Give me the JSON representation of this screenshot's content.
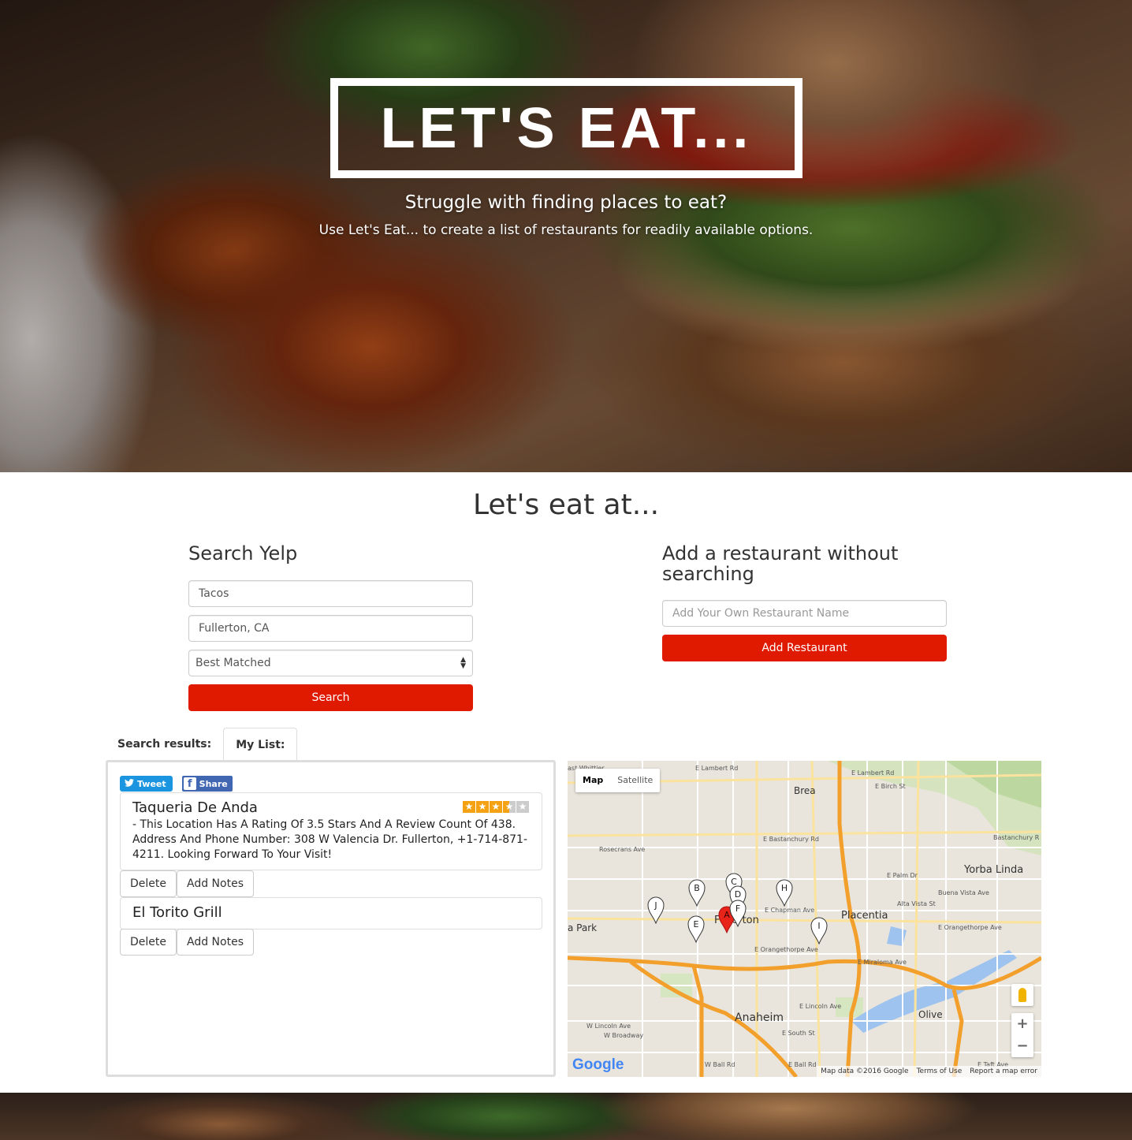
{
  "hero": {
    "title": "LET'S EAT...",
    "subtitle": "Struggle with finding places to eat?",
    "tagline": "Use Let's Eat... to create a list of restaurants for readily available options."
  },
  "section_title": "Let's eat at...",
  "search": {
    "heading": "Search Yelp",
    "term_value": "Tacos",
    "location_value": "Fullerton, CA",
    "sort_value": "Best Matched",
    "button_label": "Search"
  },
  "add": {
    "heading": "Add a restaurant without searching",
    "placeholder": "Add Your Own Restaurant Name",
    "button_label": "Add Restaurant"
  },
  "tabs": [
    {
      "label": "Search results:",
      "active": false
    },
    {
      "label": "My List:",
      "active": true
    }
  ],
  "share": {
    "tweet_label": "Tweet",
    "share_label": "Share"
  },
  "list": [
    {
      "name": "Taqueria De Anda",
      "rating": 3.5,
      "description": "- This Location Has A Rating Of 3.5 Stars And A Review Count Of 438. Address And Phone Number: 308 W Valencia Dr. Fullerton, +1-714-871-4211. Looking Forward To Your Visit!",
      "delete_label": "Delete",
      "notes_label": "Add Notes"
    },
    {
      "name": "El Torito Grill",
      "delete_label": "Delete",
      "notes_label": "Add Notes"
    }
  ],
  "map": {
    "type_map": "Map",
    "type_satellite": "Satellite",
    "labels": {
      "brea": "Brea",
      "yorba_linda": "Yorba Linda",
      "placentia": "Placentia",
      "fullerton": "Fullerton",
      "anaheim": "Anaheim",
      "olive": "Olive",
      "park": "a Park",
      "lambert": "E Lambert Rd",
      "lambert2": "E Lambert Rd",
      "birch": "E Birch St",
      "bastanchury": "E Bastanchury Rd",
      "bastanchury2": "Bastanchury R",
      "rosecrans": "Rosecrans Ave",
      "chapman": "E Chapman Ave",
      "orangethorpe": "E Orangethorpe Ave",
      "orangethorpe2": "E Orangethorpe Ave",
      "miraloma": "E Miraloma Ave",
      "lincoln": "E Lincoln Ave",
      "lincoln_w": "W Lincoln Ave",
      "broadway": "W Broadway",
      "south": "E South St",
      "ball": "W Ball Rd",
      "ball_e": "E Ball Rd",
      "taft": "E Taft Ave",
      "buena": "Buena Vista Ave",
      "alta": "Alta Vista St",
      "palm": "E Palm Dr",
      "whittier": "ast Whittier"
    },
    "markers": [
      "A",
      "B",
      "C",
      "D",
      "E",
      "F",
      "H",
      "I",
      "J"
    ],
    "google": "Google",
    "footer": [
      "Map data ©2016 Google",
      "Terms of Use",
      "Report a map error"
    ],
    "zoom_in": "+",
    "zoom_out": "−"
  },
  "colors": {
    "accent": "#e01a00",
    "star": "#f4a214",
    "tweet": "#1b95e0",
    "facebook": "#4267b2"
  }
}
